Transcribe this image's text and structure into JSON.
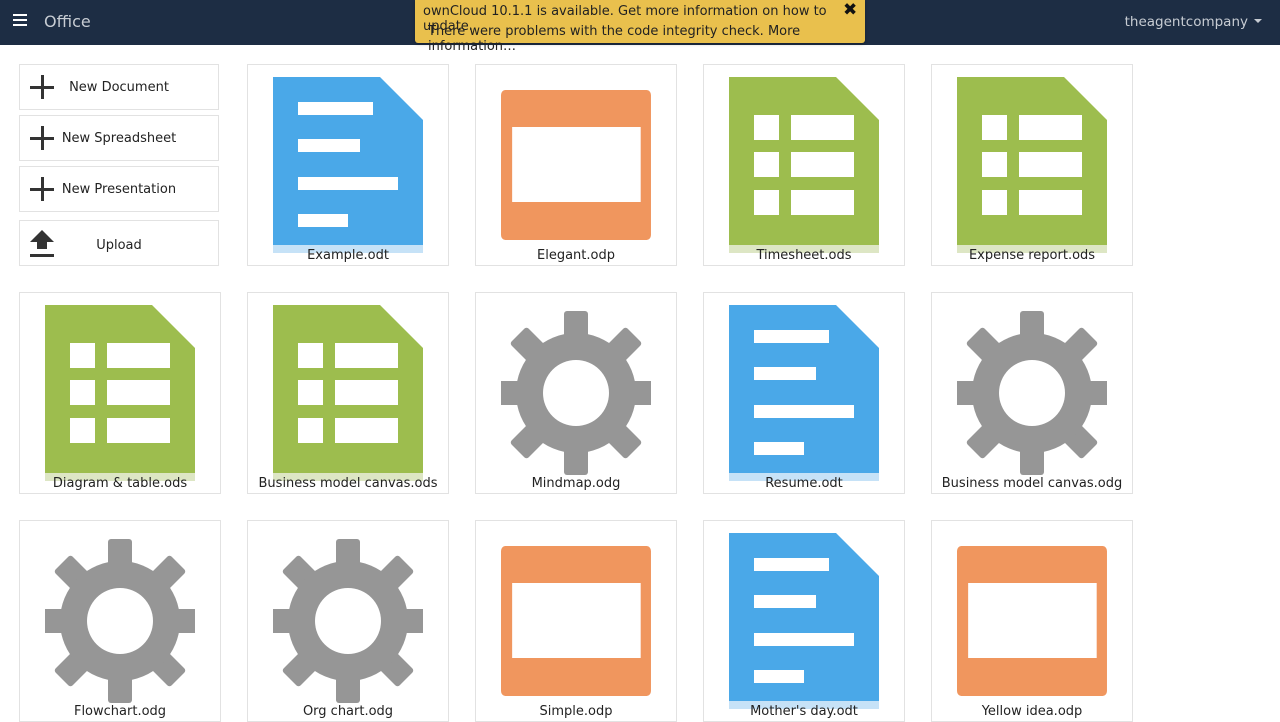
{
  "header": {
    "app_title": "Office",
    "user": "theagentcompany"
  },
  "notification": {
    "line1": "ownCloud 10.1.1 is available. Get more information on how to update.",
    "line2": "There were problems with the code integrity check. More information…",
    "close": "✖"
  },
  "actions": {
    "new_document": "New Document",
    "new_spreadsheet": "New Spreadsheet",
    "new_presentation": "New Presentation",
    "upload": "Upload"
  },
  "colors": {
    "header_bg": "#1d2d44",
    "notice_bg": "#e9c04d",
    "document": "#4aa8e8",
    "spreadsheet": "#9dbd4e",
    "presentation": "#f0965e",
    "drawing": "#969696"
  },
  "files": [
    {
      "name": "Example.odt",
      "type": "document",
      "icon": "document-icon"
    },
    {
      "name": "Elegant.odp",
      "type": "presentation",
      "icon": "presentation-icon"
    },
    {
      "name": "Timesheet.ods",
      "type": "spreadsheet",
      "icon": "spreadsheet-icon"
    },
    {
      "name": "Expense report.ods",
      "type": "spreadsheet",
      "icon": "spreadsheet-icon"
    },
    {
      "name": "Diagram & table.ods",
      "type": "spreadsheet",
      "icon": "spreadsheet-icon"
    },
    {
      "name": "Business model canvas.ods",
      "type": "spreadsheet",
      "icon": "spreadsheet-icon"
    },
    {
      "name": "Mindmap.odg",
      "type": "drawing",
      "icon": "gear-icon"
    },
    {
      "name": "Resume.odt",
      "type": "document",
      "icon": "document-icon"
    },
    {
      "name": "Business model canvas.odg",
      "type": "drawing",
      "icon": "gear-icon"
    },
    {
      "name": "Flowchart.odg",
      "type": "drawing",
      "icon": "gear-icon"
    },
    {
      "name": "Org chart.odg",
      "type": "drawing",
      "icon": "gear-icon"
    },
    {
      "name": "Simple.odp",
      "type": "presentation",
      "icon": "presentation-icon"
    },
    {
      "name": "Mother's day.odt",
      "type": "document",
      "icon": "document-icon"
    },
    {
      "name": "Yellow idea.odp",
      "type": "presentation",
      "icon": "presentation-icon"
    }
  ]
}
